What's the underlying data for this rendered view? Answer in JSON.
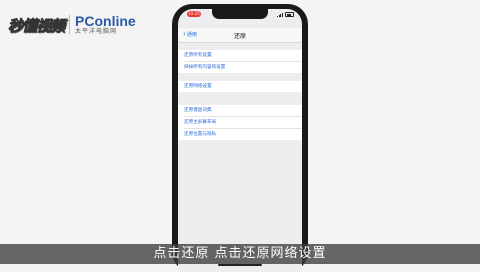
{
  "watermark": {
    "brush_text": "秒懂视频",
    "brand": "PConline",
    "brand_sub": "太平洋电脑网"
  },
  "status_bar": {
    "time": "10:25"
  },
  "nav": {
    "back_label": "通用",
    "title": "还原"
  },
  "groups": [
    {
      "items": [
        "还原所有设置",
        "抹掉所有内容和设置"
      ]
    },
    {
      "items": [
        "还原网络设置"
      ]
    },
    {
      "items": [
        "还原键盘词典",
        "还原主屏幕布局",
        "还原位置与隐私"
      ]
    }
  ],
  "subtitle": "点击还原 点击还原网络设置",
  "colors": {
    "link": "#2f6fd6",
    "accent": "#1e6fd9",
    "status": "#e53935"
  }
}
